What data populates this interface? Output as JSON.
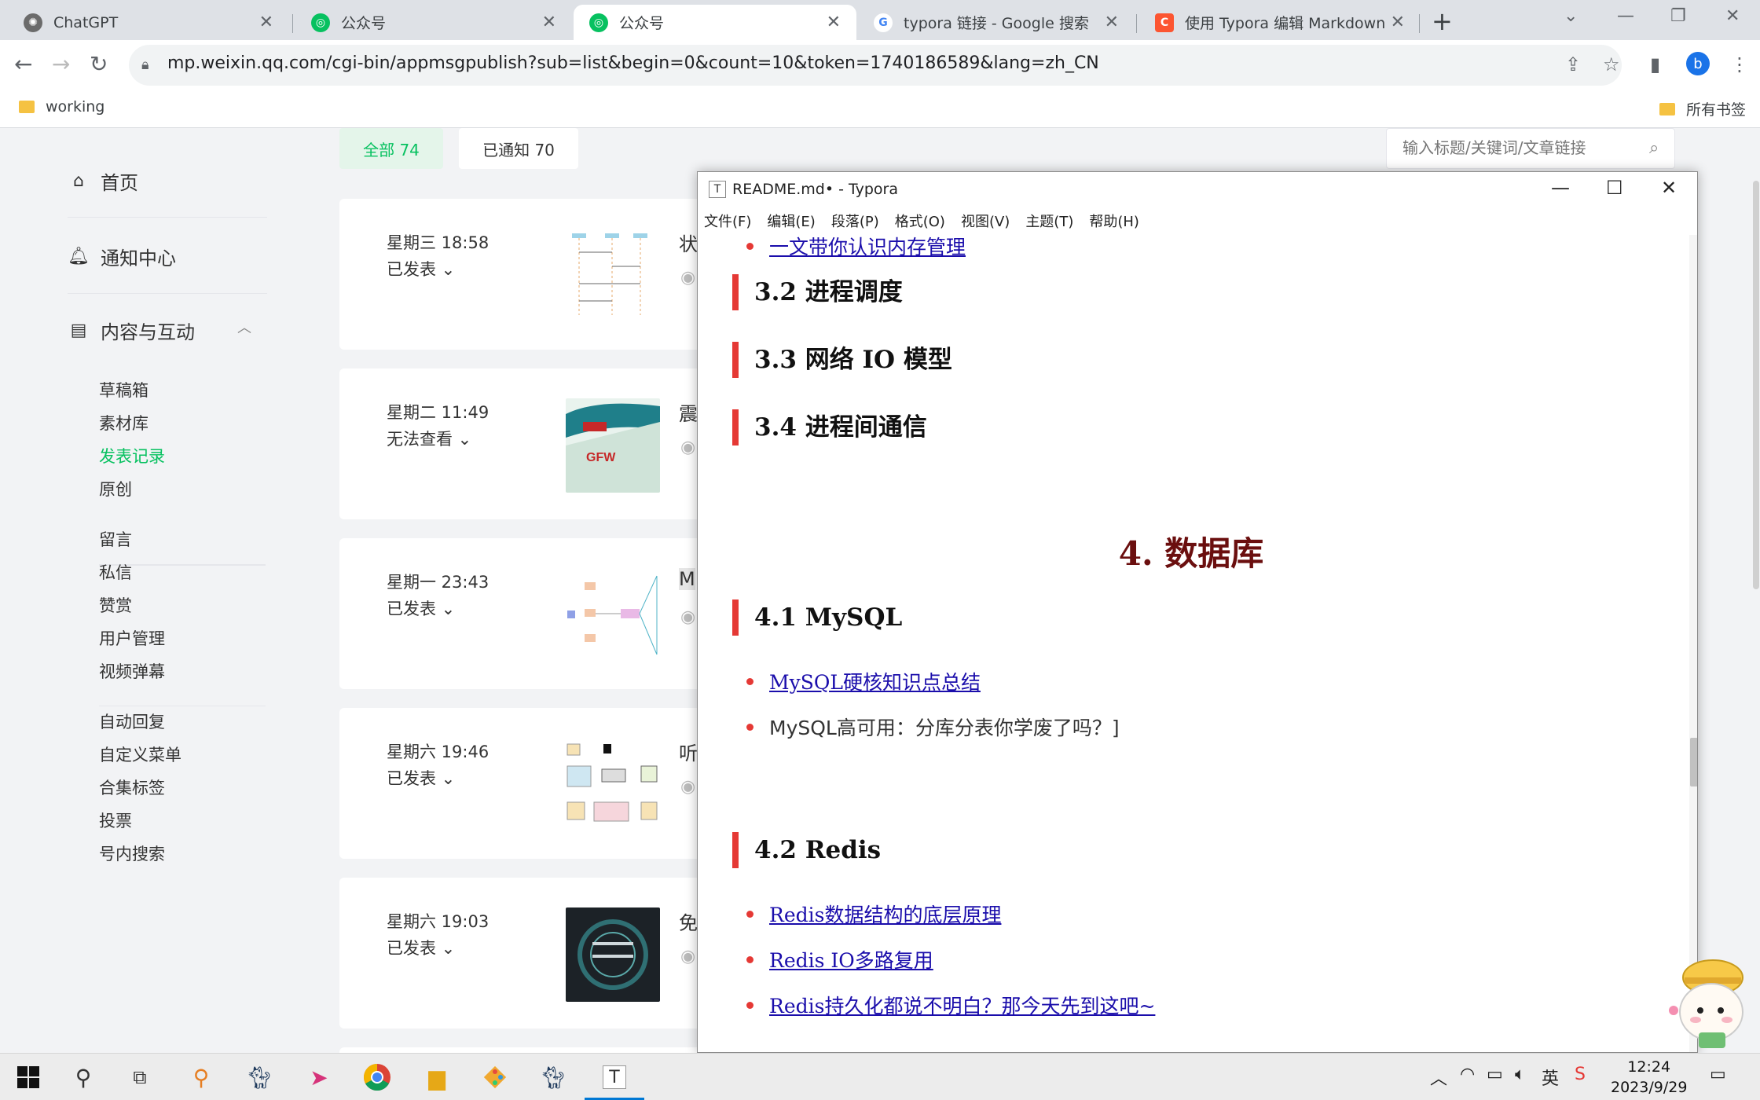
{
  "browser": {
    "tabs": [
      {
        "title": "ChatGPT",
        "icon": "chatgpt-icon",
        "active": false
      },
      {
        "title": "公众号",
        "icon": "wechat-mp-icon",
        "active": false
      },
      {
        "title": "公众号",
        "icon": "wechat-mp-icon",
        "active": true
      },
      {
        "title": "typora 链接 - Google 搜索",
        "icon": "google-icon",
        "active": false
      },
      {
        "title": "使用 Typora 编辑 Markdown 文",
        "icon": "csdn-icon",
        "active": false
      }
    ],
    "url": "mp.weixin.qq.com/cgi-bin/appmsgpublish?sub=list&begin=0&count=10&token=1740186589&lang=zh_CN",
    "profile_initial": "b",
    "bookmarks": {
      "left": "working",
      "right": "所有书签"
    }
  },
  "sidebar": {
    "home": "首页",
    "notifications": "通知中心",
    "content_interaction": "内容与互动",
    "content_items": [
      "草稿箱",
      "素材库",
      "发表记录",
      "原创"
    ],
    "interaction_items": [
      "留言",
      "私信",
      "赞赏",
      "用户管理",
      "视频弹幕"
    ],
    "feature_items": [
      "自动回复",
      "自定义菜单",
      "合集标签",
      "投票",
      "号内搜索"
    ],
    "active_item": "发表记录"
  },
  "filters": {
    "all": "全部 74",
    "notified": "已通知 70"
  },
  "search": {
    "placeholder": "输入标题/关键词/文章链接"
  },
  "posts": [
    {
      "time": "星期三 18:58",
      "status": "已发表",
      "title_prefix": "状"
    },
    {
      "time": "星期二 11:49",
      "status": "无法查看",
      "title_prefix": "震"
    },
    {
      "time": "星期一 23:43",
      "status": "已发表",
      "title_prefix": "M"
    },
    {
      "time": "星期六 19:46",
      "status": "已发表",
      "title_prefix": "听"
    },
    {
      "time": "星期六 19:03",
      "status": "已发表",
      "title_prefix": "免"
    }
  ],
  "typora": {
    "window_title": "README.md• - Typora",
    "menu": [
      "文件(F)",
      "编辑(E)",
      "段落(P)",
      "格式(O)",
      "视图(V)",
      "主题(T)",
      "帮助(H)"
    ],
    "top_link": "一文带你认识内存管理",
    "h3_32": "3.2 进程调度",
    "h3_33": "3.3 网络 IO 模型",
    "h3_34": "3.4 进程间通信",
    "h2_4": "4. 数据库",
    "h3_41": "4.1 MySQL",
    "mysql_items": [
      {
        "text": "MySQL硬核知识点总结",
        "link": true
      },
      {
        "text": "MySQL高可用：分库分表你学废了吗？]",
        "link": false
      }
    ],
    "h3_42": "4.2 Redis",
    "redis_items": [
      {
        "text": "Redis数据结构的底层原理",
        "link": true
      },
      {
        "text": "Redis IO多路复用",
        "link": true
      },
      {
        "text": "Redis持久化都说不明白？那今天先到这吧~",
        "link": true
      }
    ]
  },
  "taskbar": {
    "time": "12:24",
    "date": "2023/9/29",
    "ime": "英"
  },
  "colors": {
    "accent_green": "#07c160",
    "heading_bar": "#e53935",
    "link": "#1a0dab",
    "h2": "#6b0f0f"
  }
}
